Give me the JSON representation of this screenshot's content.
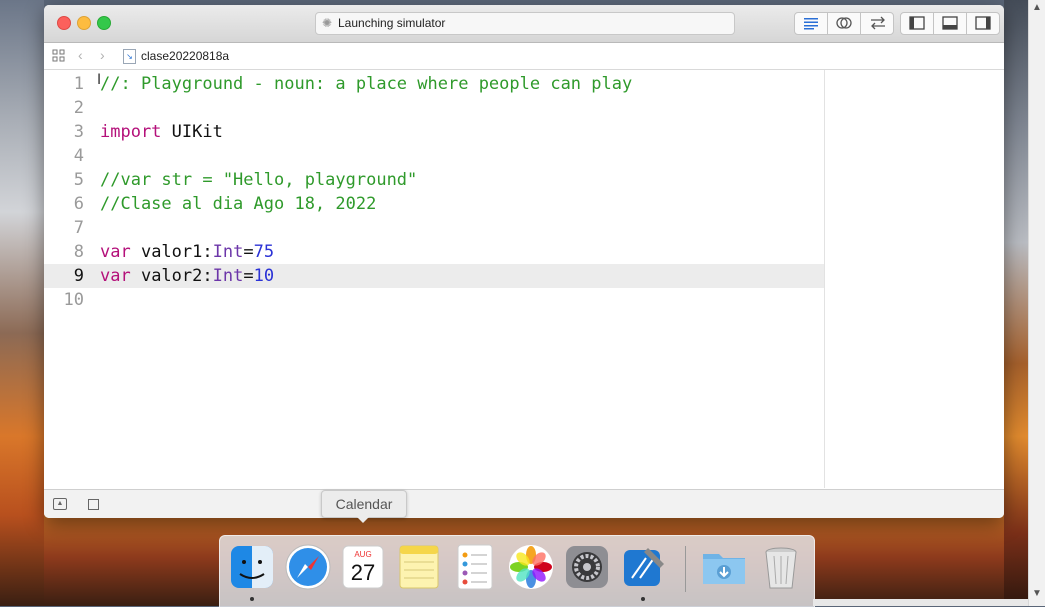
{
  "window": {
    "activity_text": "Launching simulator",
    "file_name": "clase20220818a"
  },
  "toolbar": {
    "editors": [
      "standard-editor-icon",
      "assistant-editor-icon",
      "version-editor-icon"
    ],
    "panels": [
      "navigator-panel-icon",
      "debug-area-icon",
      "utilities-panel-icon"
    ]
  },
  "editor": {
    "lines": [
      {
        "num": "1",
        "tokens": [
          {
            "t": "//: Playground - noun: a place where people can play",
            "c": "cmt"
          }
        ]
      },
      {
        "num": "2",
        "tokens": []
      },
      {
        "num": "3",
        "tokens": [
          {
            "t": "import",
            "c": "kw"
          },
          {
            "t": " UIKit",
            "c": "plain"
          }
        ]
      },
      {
        "num": "4",
        "tokens": []
      },
      {
        "num": "5",
        "tokens": [
          {
            "t": "//var str = \"Hello, playground\"",
            "c": "cmt"
          }
        ]
      },
      {
        "num": "6",
        "tokens": [
          {
            "t": "//Clase al dia Ago 18, 2022",
            "c": "cmt"
          }
        ]
      },
      {
        "num": "7",
        "tokens": []
      },
      {
        "num": "8",
        "tokens": [
          {
            "t": "var",
            "c": "kw"
          },
          {
            "t": " valor1:",
            "c": "plain"
          },
          {
            "t": "Int",
            "c": "typ"
          },
          {
            "t": "=",
            "c": "plain"
          },
          {
            "t": "75",
            "c": "num"
          }
        ]
      },
      {
        "num": "9",
        "tokens": [
          {
            "t": "var",
            "c": "kw"
          },
          {
            "t": " valor2:",
            "c": "plain"
          },
          {
            "t": "Int",
            "c": "typ"
          },
          {
            "t": "=",
            "c": "plain"
          },
          {
            "t": "10",
            "c": "num"
          }
        ]
      },
      {
        "num": "10",
        "tokens": []
      }
    ],
    "active_line": 9
  },
  "tooltip": {
    "text": "Calendar"
  },
  "dock": {
    "calendar_month": "AUG",
    "calendar_day": "27",
    "apps": [
      "finder-icon",
      "safari-icon",
      "calendar-icon",
      "notes-icon",
      "reminders-icon",
      "photos-icon",
      "system-preferences-icon",
      "xcode-icon",
      "downloads-folder-icon",
      "trash-icon"
    ]
  }
}
